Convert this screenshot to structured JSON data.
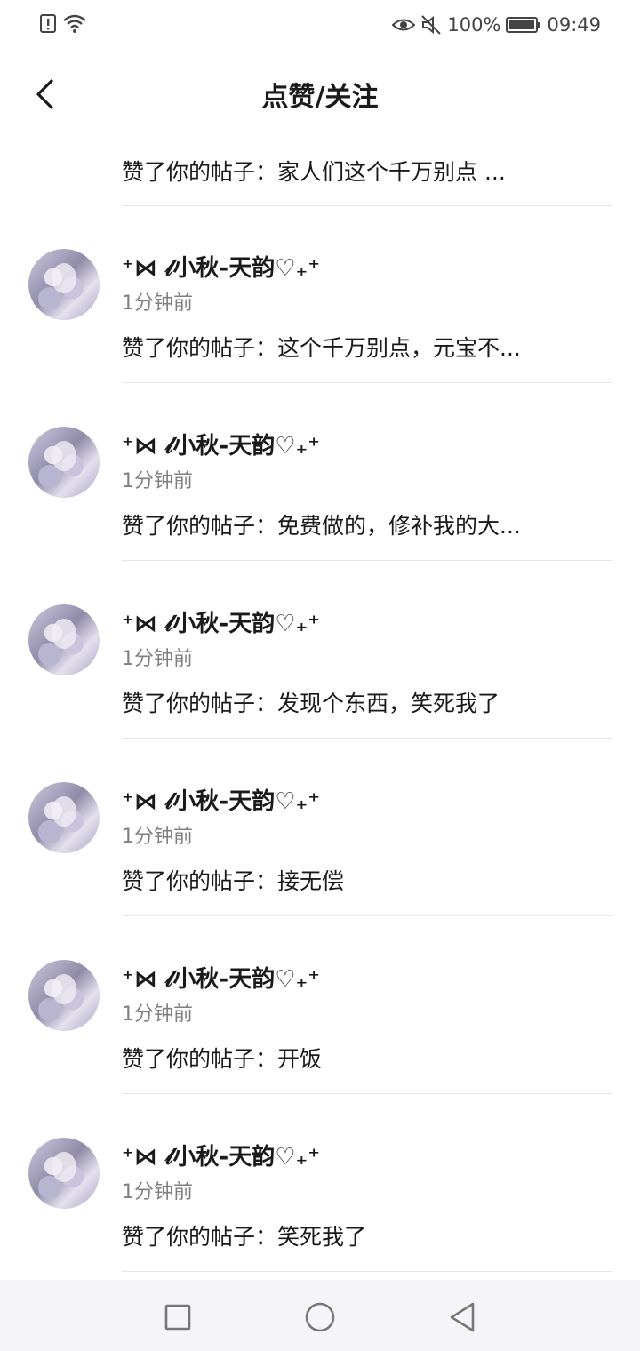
{
  "status_bar": {
    "left_icons": [
      "alert-icon",
      "wifi-icon"
    ],
    "right_icons": [
      "eye-icon",
      "mute-icon",
      "battery-icon"
    ],
    "battery": "100%",
    "time": "09:49"
  },
  "header": {
    "title": "点赞/关注",
    "back_icon": "chevron-left-icon"
  },
  "partial_item": {
    "action": "赞了你的帖子：家人们这个千万别点 ..."
  },
  "items": [
    {
      "username": "⁺⋈ 𝓁小秋-天韵♡₊⁺",
      "time": "1分钟前",
      "action": "赞了你的帖子：这个千万别点，元宝不..."
    },
    {
      "username": "⁺⋈ 𝓁小秋-天韵♡₊⁺",
      "time": "1分钟前",
      "action": "赞了你的帖子：免费做的，修补我的大..."
    },
    {
      "username": "⁺⋈ 𝓁小秋-天韵♡₊⁺",
      "time": "1分钟前",
      "action": "赞了你的帖子：发现个东西，笑死我了"
    },
    {
      "username": "⁺⋈ 𝓁小秋-天韵♡₊⁺",
      "time": "1分钟前",
      "action": "赞了你的帖子：接无偿"
    },
    {
      "username": "⁺⋈ 𝓁小秋-天韵♡₊⁺",
      "time": "1分钟前",
      "action": "赞了你的帖子：开饭"
    },
    {
      "username": "⁺⋈ 𝓁小秋-天韵♡₊⁺",
      "time": "1分钟前",
      "action": "赞了你的帖子：笑死我了"
    }
  ],
  "nav_bar": {
    "icons": [
      "square-icon",
      "circle-icon",
      "triangle-back-icon"
    ]
  }
}
